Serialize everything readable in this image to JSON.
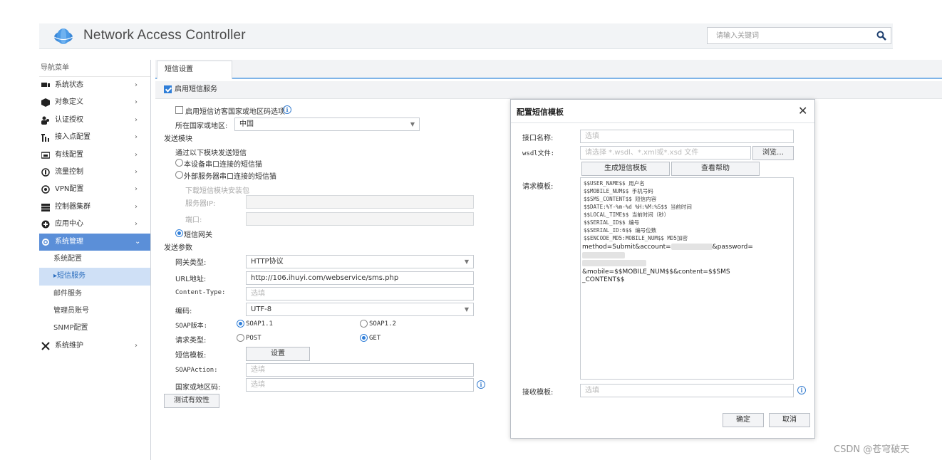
{
  "header": {
    "title": "Network Access Controller",
    "search_placeholder": "请输入关键词",
    "logo_color": "#3b88d8"
  },
  "sidebar": {
    "heading": "导航菜单",
    "items": [
      {
        "label": "系统状态",
        "icon": "monitor-icon"
      },
      {
        "label": "对象定义",
        "icon": "cube-icon"
      },
      {
        "label": "认证授权",
        "icon": "users-icon"
      },
      {
        "label": "接入点配置",
        "icon": "antenna-icon"
      },
      {
        "label": "有线配置",
        "icon": "switch-icon"
      },
      {
        "label": "流量控制",
        "icon": "flow-icon"
      },
      {
        "label": "VPN配置",
        "icon": "vpn-icon"
      },
      {
        "label": "控制器集群",
        "icon": "cluster-icon"
      },
      {
        "label": "应用中心",
        "icon": "app-icon"
      },
      {
        "label": "系统管理",
        "icon": "gear-icon"
      }
    ],
    "subitems": [
      {
        "label": "系统配置"
      },
      {
        "label": "▸短信服务"
      },
      {
        "label": "邮件服务"
      },
      {
        "label": "管理员账号"
      },
      {
        "label": "SNMP配置"
      }
    ],
    "last_item": {
      "label": "系统维护",
      "icon": "tools-icon"
    },
    "active_color": "#5b8fd8"
  },
  "tabs": {
    "active": "短信设置"
  },
  "sms": {
    "enable_label": "启用短信服务",
    "visitor_country_label": "启用短信访客国家或地区码选项",
    "country_label": "所在国家或地区:",
    "country_value": "中国",
    "send_module_title": "发送模块",
    "send_via_label": "通过以下模块发送短信",
    "opt_local_serial": "本设备串口连接的短信猫",
    "opt_external_serial": "外部服务器串口连接的短信猫",
    "download_pkg": "下载短信模块安装包",
    "server_ip_label": "服务器IP:",
    "port_label": "端口:",
    "opt_gateway": "短信网关",
    "send_params_title": "发送参数",
    "gateway_type_label": "网关类型:",
    "gateway_type_value": "HTTP协议",
    "url_label": "URL地址:",
    "url_value": "http://106.ihuyi.com/webservice/sms.php",
    "content_type_label": "Content-Type:",
    "content_type_placeholder": "选填",
    "encoding_label": "编码:",
    "encoding_value": "UTF-8",
    "soap_version_label": "SOAP版本:",
    "soap11": "SOAP1.1",
    "soap12": "SOAP1.2",
    "request_type_label": "请求类型:",
    "post": "POST",
    "get": "GET",
    "template_label": "短信模板:",
    "template_btn": "设置",
    "soap_action_label": "SOAPAction:",
    "soap_action_placeholder": "选填",
    "country_code_label": "国家或地区码:",
    "country_code_placeholder": "选填",
    "test_btn": "测试有效性"
  },
  "modal": {
    "title": "配置短信模板",
    "iface_name_label": "接口名称:",
    "iface_name_placeholder": "选填",
    "wsdl_label": "wsdl文件:",
    "wsdl_placeholder": "请选择 *.wsdl、*.xml或*.xsd 文件",
    "browse_btn": "浏览…",
    "generate_btn": "生成短信模板",
    "help_btn": "查看帮助",
    "request_tpl_label": "请求模板:",
    "tpl_lines": [
      "$$USER_NAME$$ 用户名",
      "$$MOBILE_NUM$$ 手机号码",
      "$$SMS_CONTENT$$ 短信内容",
      "$$DATE:%Y-%m-%d %H:%M:%S$$ 当前时间",
      "$$LOCAL_TIME$$ 当前时间（秒）",
      "$$SERIAL_ID$$ 编号",
      "$$SERIAL_ID:6$$ 编号位数",
      "$$ENCODE_MD5:MOBILE_NUM$$ MD5加密"
    ],
    "tpl_text_1": "method=Submit&account=",
    "tpl_text_2": "&password=",
    "tpl_text_3": "&mobile=$$MOBILE_NUM$$&content=$$SMS",
    "tpl_text_4": "_CONTENT$$",
    "receive_tpl_label": "接收模板:",
    "receive_tpl_placeholder": "选填",
    "ok_btn": "确定",
    "cancel_btn": "取消"
  },
  "watermark": "CSDN @苍穹破天"
}
